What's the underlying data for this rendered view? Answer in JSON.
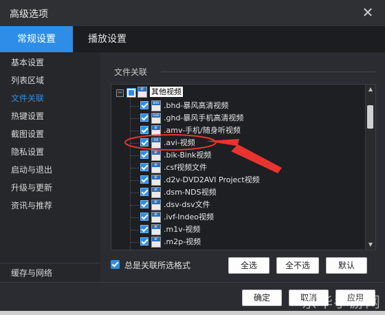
{
  "window": {
    "title": "高级选项",
    "close_glyph": "✕"
  },
  "tabs": [
    {
      "label": "常规设置",
      "active": true
    },
    {
      "label": "播放设置",
      "active": false
    }
  ],
  "sidebar": {
    "items": [
      {
        "label": "基本设置"
      },
      {
        "label": "列表区域"
      },
      {
        "label": "文件关联",
        "active": true
      },
      {
        "label": "热键设置"
      },
      {
        "label": "截图设置"
      },
      {
        "label": "隐私设置"
      },
      {
        "label": "启动与退出"
      },
      {
        "label": "升级与更新"
      },
      {
        "label": "资讯与推荐"
      }
    ],
    "bottom_item": "缓存与网络"
  },
  "section": {
    "title": "文件关联"
  },
  "tree": {
    "expander": "−",
    "root": {
      "label": "其他视频",
      "checked": "partial"
    },
    "items": [
      {
        "label": ".bhd-暴风高清视频",
        "icon_tag": "BHD",
        "checked": true
      },
      {
        "label": ".ghd-暴风手机高清视频",
        "icon_tag": "GHD",
        "checked": true
      },
      {
        "label": ".amv-手机/随身听视频",
        "icon_tag": "BF",
        "checked": true
      },
      {
        "label": ".avi-视频",
        "icon_tag": "AVI",
        "checked": true
      },
      {
        "label": ".bik-Bink视频",
        "icon_tag": "BF",
        "checked": true
      },
      {
        "label": ".csf视频文件",
        "icon_tag": "BF",
        "checked": true
      },
      {
        "label": ".d2v-DVD2AVI Project视频",
        "icon_tag": "BF",
        "checked": true
      },
      {
        "label": ".dsm-NDS视频",
        "icon_tag": "BF",
        "checked": true
      },
      {
        "label": ".dsv-dsv文件",
        "icon_tag": "BF",
        "checked": true
      },
      {
        "label": ".ivf-Indeo视频",
        "icon_tag": "BF",
        "checked": true
      },
      {
        "label": ".m1v-视频",
        "icon_tag": "BF",
        "checked": true
      },
      {
        "label": ".m2p-视频",
        "icon_tag": "BF",
        "checked": true
      }
    ],
    "scroll_up": "▲",
    "scroll_down": "▼"
  },
  "options": {
    "always_associate_label": "总是关联所选格式",
    "always_associate_checked": true
  },
  "buttons": {
    "select_all": "全选",
    "select_none": "全不选",
    "default": "默认",
    "ok": "确定",
    "cancel": "取消",
    "apply": "应用"
  },
  "annotation": {
    "color": "#e8342f"
  },
  "watermark": "京华手游网",
  "colors": {
    "accent": "#2e8de6",
    "background": "#2b2c31",
    "tabbar": "#1c1d21",
    "sidebar": "#26272b"
  }
}
